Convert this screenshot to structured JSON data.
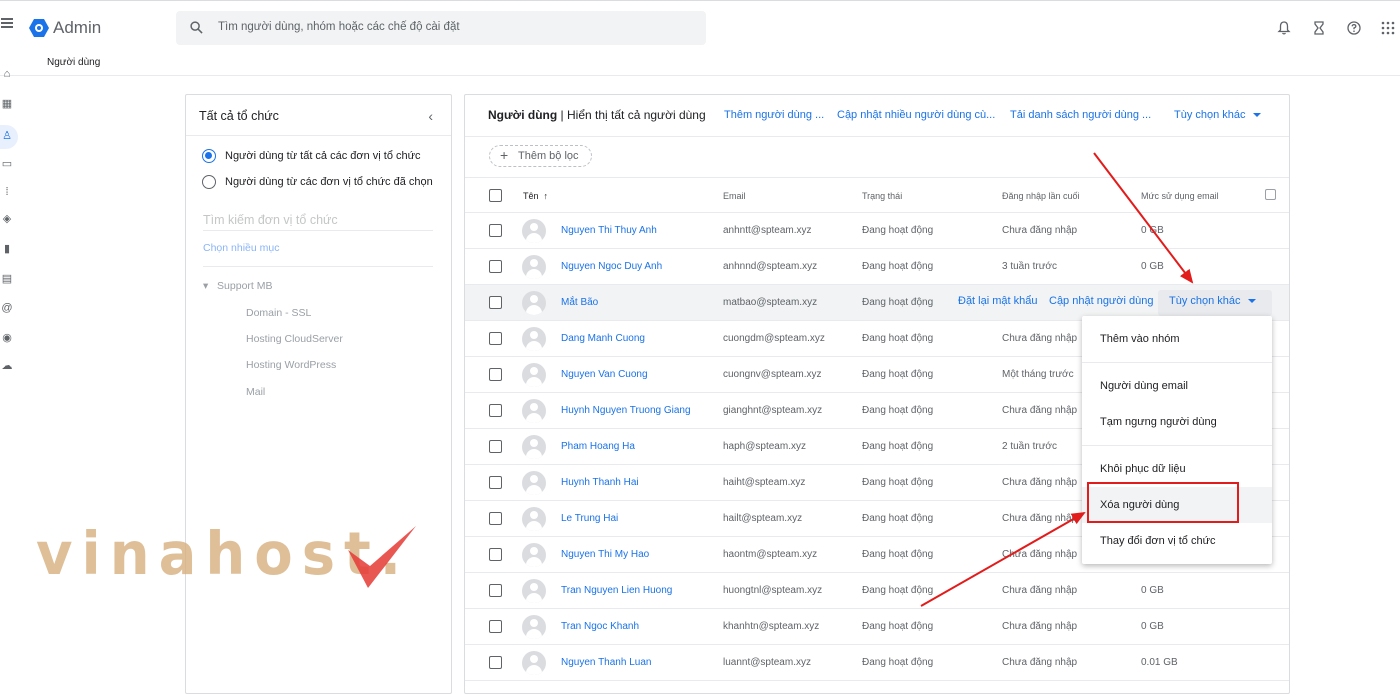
{
  "header": {
    "brand": "Admin",
    "search_placeholder": "Tìm người dùng, nhóm hoặc các chế độ cài đặt"
  },
  "breadcrumb": "Người dùng",
  "org_panel": {
    "title": "Tất cả tổ chức",
    "radio_all": "Người dùng từ tất cả các đơn vị tổ chức",
    "radio_selected": "Người dùng từ các đơn vị tổ chức đã chọn",
    "search_placeholder": "Tìm kiếm đơn vị tổ chức",
    "multi_select": "Chọn nhiều mục",
    "tree_root": "Support MB",
    "tree_children": [
      "Domain - SSL",
      "Hosting CloudServer",
      "Hosting WordPress",
      "Mail"
    ]
  },
  "users_panel": {
    "title_bold": "Người dùng",
    "title_rest": " | Hiển thị tất cả người dùng",
    "actions": [
      "Thêm người dùng ...",
      "Cập nhật nhiều người dùng cù...",
      "Tải danh sách người dùng ...",
      "Tùy chọn khác"
    ],
    "add_filter": "Thêm bộ lọc",
    "columns": [
      "Tên",
      "Email",
      "Trạng thái",
      "Đăng nhập lần cuối",
      "Mức sử dụng email"
    ],
    "sort_indicator": "↑",
    "rows": [
      {
        "name": "Nguyen Thi Thuy Anh",
        "email": "anhntt@spteam.xyz",
        "status": "Đang hoạt động",
        "last_login": "Chưa đăng nhập",
        "usage": "0 GB"
      },
      {
        "name": "Nguyen Ngoc Duy Anh",
        "email": "anhnnd@spteam.xyz",
        "status": "Đang hoạt động",
        "last_login": "3 tuần trước",
        "usage": "0 GB"
      },
      {
        "name": "Mắt Bão",
        "email": "matbao@spteam.xyz",
        "status": "Đang hoạt động",
        "last_login": "",
        "usage": ""
      },
      {
        "name": "Dang Manh Cuong",
        "email": "cuongdm@spteam.xyz",
        "status": "Đang hoạt động",
        "last_login": "Chưa đăng nhập",
        "usage": ""
      },
      {
        "name": "Nguyen Van Cuong",
        "email": "cuongnv@spteam.xyz",
        "status": "Đang hoạt động",
        "last_login": "Một tháng trước",
        "usage": ""
      },
      {
        "name": "Huynh Nguyen Truong Giang",
        "email": "gianghnt@spteam.xyz",
        "status": "Đang hoạt động",
        "last_login": "Chưa đăng nhập",
        "usage": ""
      },
      {
        "name": "Pham Hoang Ha",
        "email": "haph@spteam.xyz",
        "status": "Đang hoạt động",
        "last_login": "2 tuần trước",
        "usage": ""
      },
      {
        "name": "Huynh Thanh Hai",
        "email": "haiht@spteam.xyz",
        "status": "Đang hoạt động",
        "last_login": "Chưa đăng nhập",
        "usage": ""
      },
      {
        "name": "Le Trung Hai",
        "email": "hailt@spteam.xyz",
        "status": "Đang hoạt động",
        "last_login": "Chưa đăng nhập",
        "usage": ""
      },
      {
        "name": "Nguyen Thi My Hao",
        "email": "haontm@spteam.xyz",
        "status": "Đang hoạt động",
        "last_login": "Chưa đăng nhập",
        "usage": ""
      },
      {
        "name": "Tran Nguyen Lien Huong",
        "email": "huongtnl@spteam.xyz",
        "status": "Đang hoạt động",
        "last_login": "Chưa đăng nhập",
        "usage": "0 GB"
      },
      {
        "name": "Tran Ngoc Khanh",
        "email": "khanhtn@spteam.xyz",
        "status": "Đang hoạt động",
        "last_login": "Chưa đăng nhập",
        "usage": "0 GB"
      },
      {
        "name": "Nguyen Thanh Luan",
        "email": "luannt@spteam.xyz",
        "status": "Đang hoạt động",
        "last_login": "Chưa đăng nhập",
        "usage": "0.01 GB"
      }
    ],
    "row_actions": {
      "reset_password": "Đặt lại mật khẩu",
      "update_user": "Cập nhật người dùng",
      "more_options": "Tùy chọn khác"
    }
  },
  "menu": {
    "items": [
      "Thêm vào nhóm",
      "Người dùng email",
      "Tạm ngưng người dùng",
      "Khôi phục dữ liệu",
      "Xóa người dùng",
      "Thay đổi đơn vị tổ chức"
    ]
  },
  "watermark": "vinahost.",
  "colors": {
    "accent": "#1a73e8",
    "highlight_box": "#e21b1b",
    "watermark": "#d7b07f"
  }
}
